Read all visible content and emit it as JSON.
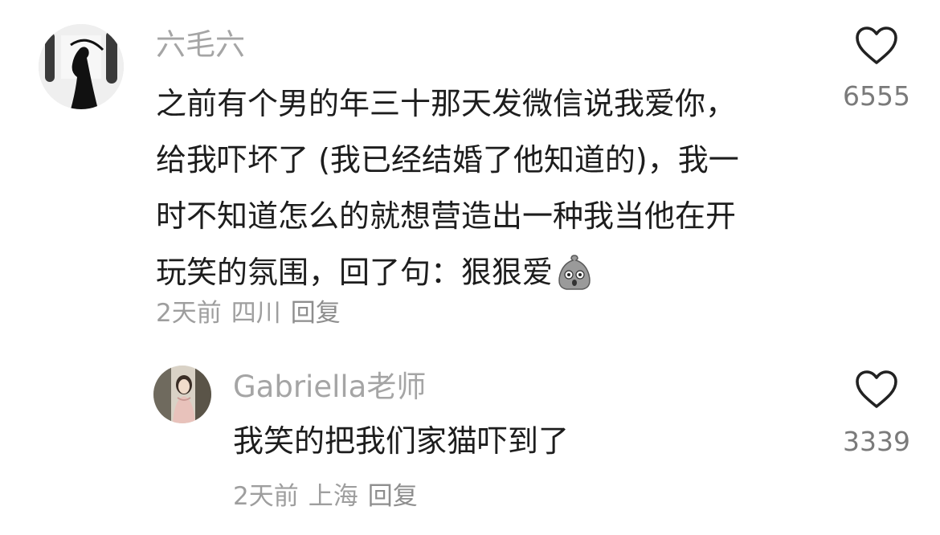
{
  "comment": {
    "username": "六毛六",
    "avatar_icon": "reaper-silhouette-avatar",
    "lines": [
      "之前有个男的年三十那天发微信说我爱你，",
      "给我吓坏了 (我已经结婚了他知道的)，我一",
      "时不知道怎么的就想营造出一种我当他在开",
      "玩笑的氛围，回了句：狠狠爱"
    ],
    "emoji_icon": "shocked-bag-emoji",
    "time": "2天前",
    "location": "四川",
    "reply_label": "回复",
    "like_icon": "heart-outline-icon",
    "like_count": "6555"
  },
  "reply": {
    "username": "Gabriella老师",
    "avatar_icon": "woman-portrait-avatar",
    "text": "我笑的把我们家猫吓到了",
    "time": "2天前",
    "location": "上海",
    "reply_label": "回复",
    "like_icon": "heart-outline-icon",
    "like_count": "3339"
  },
  "colors": {
    "username": "#a5a5a5",
    "body": "#1d1d1d",
    "meta": "#9e9e9e",
    "like_count": "#7a7a7a"
  }
}
